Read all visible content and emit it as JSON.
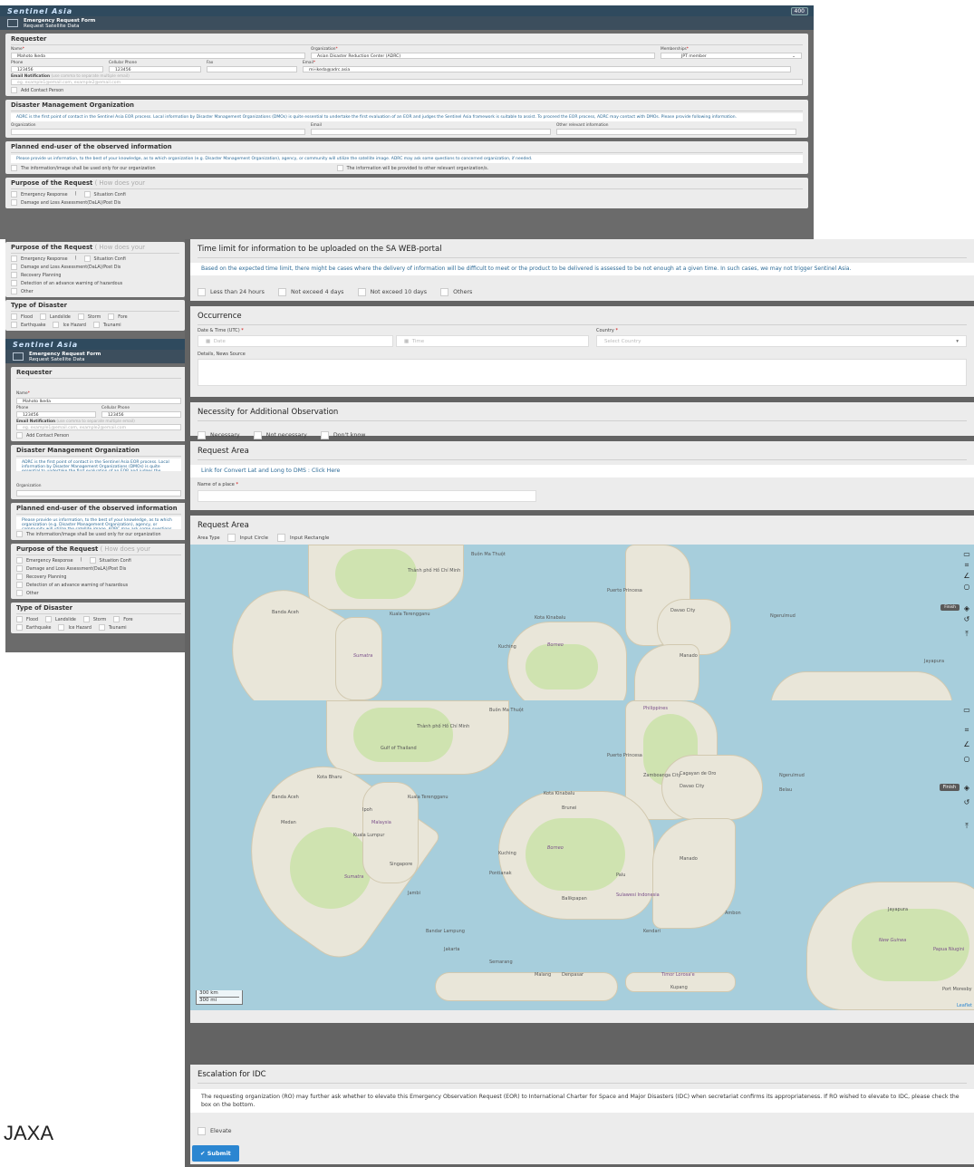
{
  "app": {
    "logo": "Sentinel Asia",
    "badge": "400",
    "form_title": "Emergency Request Form",
    "form_subtitle": "Request Satellite Data"
  },
  "requester": {
    "title": "Requester",
    "name_label": "Name",
    "name_value": "Mahoto Ikeda",
    "org_label": "Organization",
    "org_value": "Asian Disaster Reduction Center (ADRC)",
    "membership_label": "Memberships",
    "membership_value": "JPT member",
    "phone_label": "Phone",
    "phone_value": "123456",
    "cell_label": "Cellular Phone",
    "cell_value": "123456",
    "fax_label": "Fax",
    "email_label": "Email",
    "email_value": "mi-ikeda@adrc.asia",
    "notif_label": "Email Notification",
    "notif_hint": "(use comma to separate multiple email)",
    "notif_placeholder": "eg. example1@email.com, example2@email.com",
    "add_contact": "Add Contact Person"
  },
  "dmo": {
    "title": "Disaster Management Organization",
    "note": "ADRC is the first point of contact in the Sentinel Asia EOR process. Local information by Disaster Management Organizations (DMOs) is quite essential to undertake the first evaluation of an EOR and judges the Sentinel Asia framework is suitable to assist. To proceed the EOR process, ADRC may contact with DMOs. Please provide following information.",
    "org_label": "Organization",
    "email_label": "Email",
    "other_label": "Other relevant information"
  },
  "enduser": {
    "title": "Planned end-user of the observed information",
    "note": "Please provide us information, to the best of your knowledge, as to which organization (e.g. Disaster Management Organization), agency, or community will utilize the satellite image. ADRC may ask some questions to concerned organization, if needed.",
    "opt1": "The information/image shall be used only for our organization",
    "opt2": "The information will be provided to other relevant organization/s."
  },
  "purpose": {
    "title": "Purpose of the Request",
    "hint": "( How does your",
    "opt1": "Emergency Response",
    "opt1b": "(",
    "opt1c": "Situation Confi",
    "opt2": "Damage and Loss Assessment(DaLA)/Post Dis",
    "opt3": "Recovery Planning",
    "opt4": "Detection of an advance warning of hazardous",
    "opt5": "Other"
  },
  "disaster": {
    "title": "Type of Disaster",
    "items": [
      "Flood",
      "Landslide",
      "Storm",
      "Fore",
      "Earthquake",
      "Ice Hazard",
      "Tsunami"
    ]
  },
  "timelimit": {
    "title": "Time limit for information to be uploaded on the SA WEB-portal",
    "note": "Based on the expected time limit, there might be cases where the delivery of information will be difficult to meet or the product to be delivered is assessed to be not enough at a given time. In such cases, we may not trigger Sentinel Asia.",
    "options": [
      "Less than 24 hours",
      "Not exceed 4 days",
      "Not exceed 10 days",
      "Others"
    ]
  },
  "occurrence": {
    "title": "Occurrence",
    "dt_label": "Date & Time (UTC)",
    "date_ph": "Date",
    "time_ph": "Time",
    "country_label": "Country",
    "country_ph": "Select Country",
    "details_label": "Details, News Source"
  },
  "necessity": {
    "title": "Necessity for Additional Observation",
    "options": [
      "Necessary",
      "Not necessary",
      "Don't know"
    ]
  },
  "reqarea1": {
    "title": "Request Area",
    "link": "Link for Convert Lat and Long to DMS : Click Here",
    "place_label": "Name of a place"
  },
  "reqarea2": {
    "title": "Request Area",
    "area_type": "Area Type",
    "opt1": "Input Circle",
    "opt2": "Input Rectangle"
  },
  "map": {
    "labels": {
      "bmt": "Buôn Ma Thuột",
      "hcm": "Thành phố Hồ Chí Minh",
      "gulf": "Gulf of Thailand",
      "pp": "Puerto Princesa",
      "zamb": "Zamboanga City",
      "davao": "Davao City",
      "cag": "Cagayan de Oro",
      "phil": "Philippines",
      "banda": "Banda Aceh",
      "kb": "Kota Bharu",
      "kt": "Kuala Terengganu",
      "kk": "Kota Kinabalu",
      "brunei": "Brunei",
      "medan": "Medan",
      "malaysia": "Malaysia",
      "kl": "Kuala Lumpur",
      "ipoh": "Ipoh",
      "sg": "Singapore",
      "kuching": "Kuching",
      "borneo": "Borneo",
      "sumatra": "Sumatra",
      "pontianak": "Pontianak",
      "palu": "Palu",
      "manado": "Manado",
      "ngerulmud": "Ngerulmud",
      "belau": "Belau",
      "jambi": "Jambi",
      "balik": "Balikpapan",
      "sulawesi": "Sulawesi Indonesia",
      "ambon": "Ambon",
      "jaya": "Jayapura",
      "bl": "Bandar Lampung",
      "jakarta": "Jakarta",
      "kendari": "Kendari",
      "semarang": "Semarang",
      "malang": "Malang",
      "denpasar": "Denpasar",
      "timor": "Timor Lorosa'e",
      "ng": "New Guinea",
      "png": "Papua Niugini",
      "kupang": "Kupang",
      "pm": "Port Moresby",
      "finish": "Finish",
      "scale_km": "300 km",
      "scale_mi": "300 mi",
      "leaflet": "Leaflet"
    }
  },
  "idc": {
    "title": "Escalation for IDC",
    "note": "The requesting organization (RO) may further ask whether to elevate this Emergency Observation Request (EOR) to International Charter for Space and Major Disasters (IDC) when secretariat confirms its appropriateness. If RO wished to elevate to IDC, please check the box on the bottom.",
    "elevate": "Elevate"
  },
  "submit": "Submit",
  "footer": "JAXA"
}
